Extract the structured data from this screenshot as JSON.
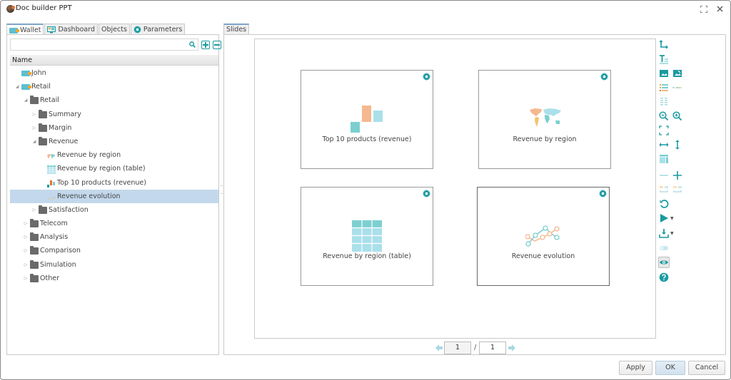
{
  "window": {
    "title": "Doc builder PPT",
    "icons": {
      "app": "app-logo-icon",
      "maximize": "maximize-icon",
      "close": "close-icon"
    }
  },
  "left": {
    "tabs": [
      {
        "label": "Wallet",
        "icon": "wallet-icon",
        "active": true
      },
      {
        "label": "Dashboard",
        "icon": "dashboard-icon",
        "active": false
      },
      {
        "label": "Objects",
        "icon": "",
        "active": false
      },
      {
        "label": "Parameters",
        "icon": "gear-icon",
        "active": false
      }
    ],
    "search": {
      "value": "",
      "placeholder": ""
    },
    "tree_header": "Name",
    "tree": [
      {
        "label": "John",
        "level": 0,
        "type": "wallet",
        "expand": "none"
      },
      {
        "label": "Retail",
        "level": 0,
        "type": "wallet",
        "expand": "open"
      },
      {
        "label": "Retail",
        "level": 1,
        "type": "folder",
        "expand": "open"
      },
      {
        "label": "Summary",
        "level": 2,
        "type": "folder",
        "expand": "closed"
      },
      {
        "label": "Margin",
        "level": 2,
        "type": "folder",
        "expand": "closed"
      },
      {
        "label": "Revenue",
        "level": 2,
        "type": "folder",
        "expand": "open"
      },
      {
        "label": "Revenue by region",
        "level": 3,
        "type": "map",
        "expand": "none"
      },
      {
        "label": "Revenue by region (table)",
        "level": 3,
        "type": "table",
        "expand": "none"
      },
      {
        "label": "Top 10 products (revenue)",
        "level": 3,
        "type": "bar",
        "expand": "none"
      },
      {
        "label": "Revenue evolution",
        "level": 3,
        "type": "line",
        "expand": "none",
        "selected": true
      },
      {
        "label": "Satisfaction",
        "level": 2,
        "type": "folder",
        "expand": "closed"
      },
      {
        "label": "Telecom",
        "level": 1,
        "type": "folder",
        "expand": "closed"
      },
      {
        "label": "Analysis",
        "level": 1,
        "type": "folder",
        "expand": "closed"
      },
      {
        "label": "Comparison",
        "level": 1,
        "type": "folder",
        "expand": "closed"
      },
      {
        "label": "Simulation",
        "level": 1,
        "type": "folder",
        "expand": "closed"
      },
      {
        "label": "Other",
        "level": 1,
        "type": "folder",
        "expand": "closed"
      }
    ]
  },
  "right": {
    "tab_label": "Slides",
    "slides": [
      {
        "caption": "Top 10 products (revenue)",
        "thumb": "bar-chart-thumb",
        "selected": false
      },
      {
        "caption": "Revenue by region",
        "thumb": "world-map-thumb",
        "selected": false
      },
      {
        "caption": "Revenue by region (table)",
        "thumb": "table-thumb",
        "selected": false
      },
      {
        "caption": "Revenue evolution",
        "thumb": "line-chart-thumb",
        "selected": true
      }
    ],
    "pager": {
      "current": "1",
      "separator": "/",
      "total": "1"
    },
    "toolbar": [
      "axes-icon",
      "text-icon",
      "image-icon",
      "image-edit-icon",
      "list-style-icon",
      "dashed-line-icon",
      "column-layout-icon",
      "zoom-out-icon",
      "zoom-in-icon",
      "fit-screen-icon",
      "fit-width-icon",
      "fit-height-icon",
      "layout-icon",
      "minus-icon",
      "plus-icon",
      "swap-left-icon",
      "swap-right-icon",
      "refresh-icon",
      "play-icon",
      "download-icon",
      "toggle-icon",
      "eye-icon",
      "help-icon"
    ]
  },
  "footer": {
    "apply": "Apply",
    "ok": "OK",
    "cancel": "Cancel"
  },
  "colors": {
    "accent": "#1a9aa0",
    "selection": "#c3d8ec",
    "orange": "#f5b88f",
    "teal_light": "#a9e0ea",
    "teal": "#7ccfd0"
  }
}
